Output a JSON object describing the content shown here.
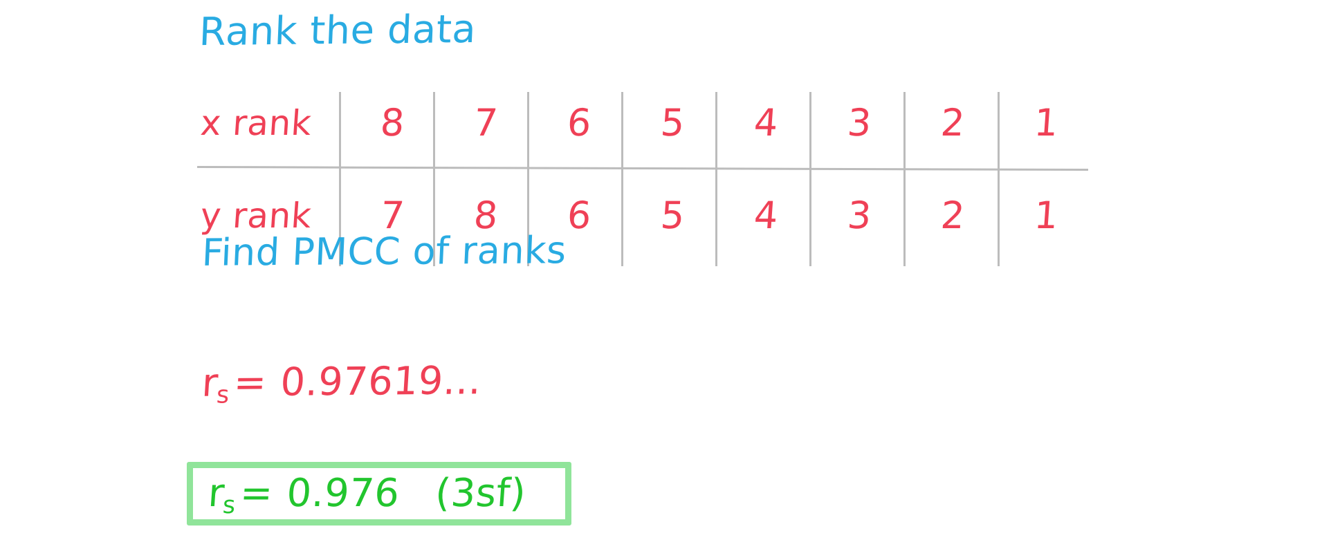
{
  "heading": "Rank the data",
  "colors": {
    "blue": "#29abe2",
    "red": "#ef4056",
    "green": "#22c52e",
    "box_border": "#90e49a",
    "gridline": "#bcbcbc",
    "background": "#ffffff"
  },
  "table": {
    "rows": [
      {
        "label": "x rank",
        "values": [
          "8",
          "7",
          "6",
          "5",
          "4",
          "3",
          "2",
          "1"
        ]
      },
      {
        "label": "y rank",
        "values": [
          "7",
          "8",
          "6",
          "5",
          "4",
          "3",
          "2",
          "1"
        ]
      }
    ]
  },
  "instruction": "Find  PMCC   of   ranks",
  "working": {
    "symbol": "r",
    "subscript": "s",
    "equals": "=",
    "value": "0.97619..."
  },
  "answer": {
    "symbol": "r",
    "subscript": "s",
    "equals": "=",
    "value": "0.976",
    "precision_note": "(3sf)"
  }
}
